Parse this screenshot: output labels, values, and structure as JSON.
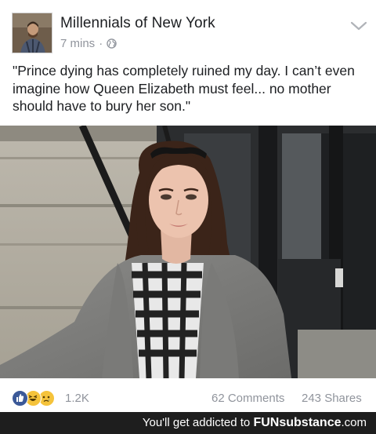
{
  "post": {
    "page_name": "Millennials of New York",
    "time": "7 mins",
    "separator": "·",
    "text": "\"Prince dying has completely ruined my day. I can’t even imagine how Queen Elizabeth must feel... no mother should have to bury her son.\""
  },
  "reactions": {
    "types": [
      "like-icon",
      "haha-icon",
      "sad-icon"
    ],
    "count": "1.2K"
  },
  "engagement": {
    "comments": "62 Comments",
    "shares": "243 Shares"
  },
  "banner": {
    "prefix": "You'll get addicted to",
    "brand_part1": "FUN",
    "brand_part2": "substance",
    "brand_part3": ".com"
  },
  "colors": {
    "meta_gray": "#90949c",
    "text_dark": "#1c1e21",
    "like_blue": "#3b5998",
    "reaction_yellow": "#f5c33b",
    "banner_bg": "#1e1e1e"
  }
}
